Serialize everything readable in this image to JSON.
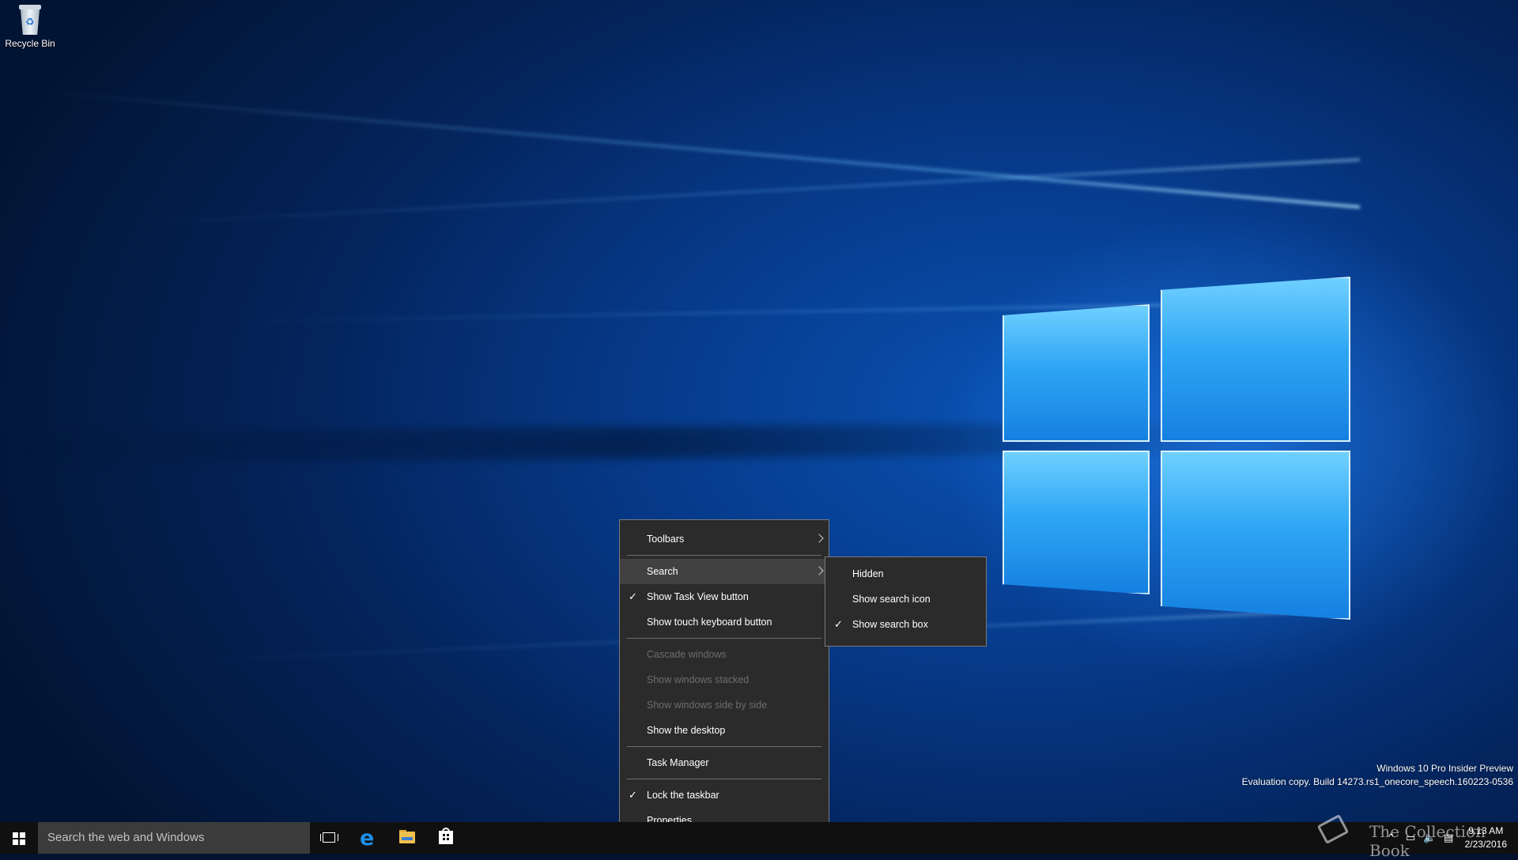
{
  "desktop": {
    "icons": [
      {
        "label": "Recycle Bin",
        "icon": "recycle-bin-icon"
      }
    ]
  },
  "context_menu": {
    "groups": [
      [
        {
          "label": "Toolbars",
          "submenu": true
        },
        {
          "label": "Search",
          "submenu": true,
          "highlighted": true
        },
        {
          "label": "Show Task View button",
          "checked": true
        },
        {
          "label": "Show touch keyboard button"
        }
      ],
      [
        {
          "label": "Cascade windows",
          "disabled": true
        },
        {
          "label": "Show windows stacked",
          "disabled": true
        },
        {
          "label": "Show windows side by side",
          "disabled": true
        },
        {
          "label": "Show the desktop"
        }
      ],
      [
        {
          "label": "Task Manager"
        }
      ],
      [
        {
          "label": "Lock the taskbar",
          "checked": true
        },
        {
          "label": "Properties"
        }
      ]
    ]
  },
  "search_submenu": {
    "items": [
      {
        "label": "Hidden"
      },
      {
        "label": "Show search icon"
      },
      {
        "label": "Show search box",
        "checked": true
      }
    ]
  },
  "taskbar": {
    "search_placeholder": "Search the web and Windows",
    "pinned": [
      {
        "name": "task-view-icon"
      },
      {
        "name": "edge-icon"
      },
      {
        "name": "file-explorer-icon"
      },
      {
        "name": "store-icon"
      }
    ],
    "clock": {
      "time": "9:13 AM",
      "date": "2/23/2016"
    }
  },
  "watermark": {
    "line1": "Windows 10 Pro Insider Preview",
    "line2": "Evaluation copy. Build 14273.rs1_onecore_speech.160223-0536"
  },
  "logo_overlay": {
    "text": "The Collection Book"
  },
  "colors": {
    "menu_bg": "#2b2b2b",
    "menu_highlight": "#414141",
    "taskbar_bg": "#101010",
    "search_bg": "#3b3b3b",
    "accent": "#1e8fe8"
  }
}
